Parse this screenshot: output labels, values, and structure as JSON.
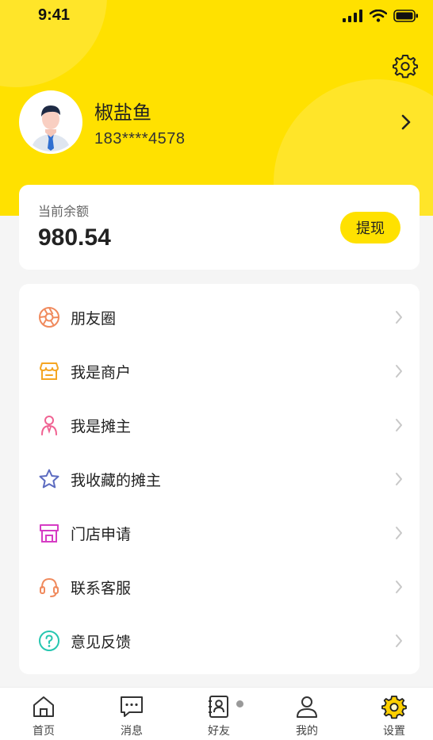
{
  "status_bar": {
    "time": "9:41"
  },
  "profile": {
    "name": "椒盐鱼",
    "phone": "183****4578"
  },
  "balance": {
    "label": "当前余额",
    "value": "980.54",
    "withdraw_label": "提现"
  },
  "menu": [
    {
      "label": "朋友圈",
      "icon": "aperture-icon",
      "color": "#f08a5d"
    },
    {
      "label": "我是商户",
      "icon": "store-icon",
      "color": "#f5a623"
    },
    {
      "label": "我是摊主",
      "icon": "person-icon",
      "color": "#f06292"
    },
    {
      "label": "我收藏的摊主",
      "icon": "star-icon",
      "color": "#5c6bc0"
    },
    {
      "label": "门店申请",
      "icon": "shop-icon",
      "color": "#d63cc4"
    },
    {
      "label": "联系客服",
      "icon": "headset-icon",
      "color": "#f08a5d"
    },
    {
      "label": "意见反馈",
      "icon": "question-icon",
      "color": "#26c6b0"
    }
  ],
  "tabbar": [
    {
      "label": "首页",
      "icon": "home-icon"
    },
    {
      "label": "消息",
      "icon": "message-icon"
    },
    {
      "label": "好友",
      "icon": "contacts-icon"
    },
    {
      "label": "我的",
      "icon": "user-icon"
    },
    {
      "label": "设置",
      "icon": "gear-icon",
      "active_color": "#ffd000"
    }
  ]
}
